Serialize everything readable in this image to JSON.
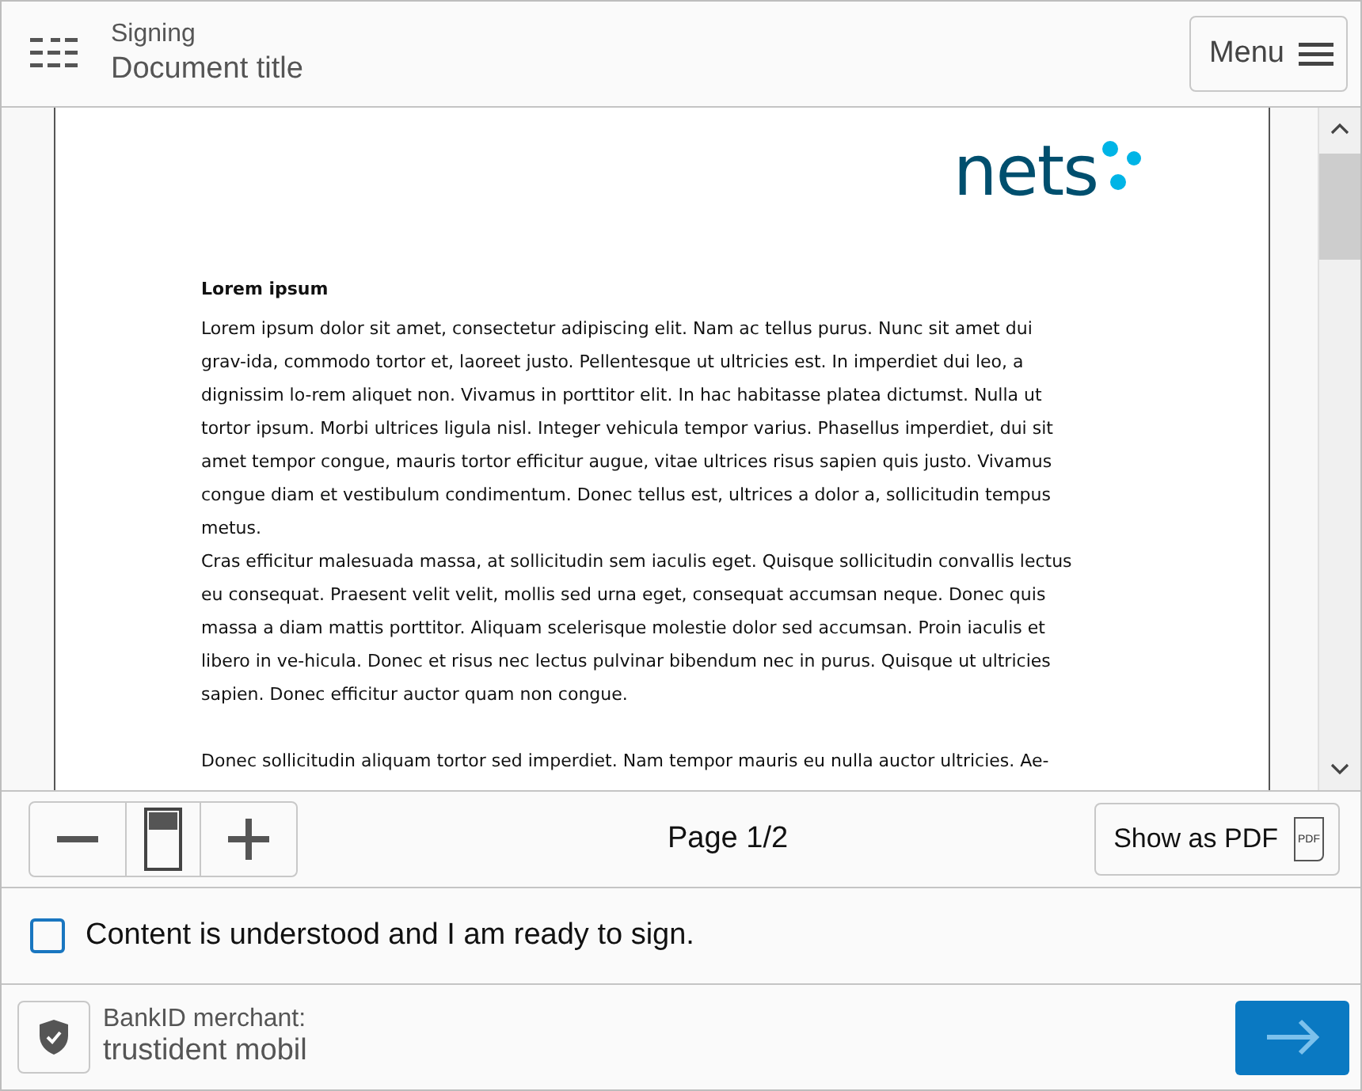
{
  "header": {
    "subtitle": "Signing",
    "title": "Document title",
    "menu_button": "Menu"
  },
  "document": {
    "logo": "nets",
    "heading": "Lorem ipsum",
    "paragraphs": [
      [
        "Lorem ipsum dolor sit amet, consectetur adipiscing elit. Nam ac tellus purus. Nunc sit amet dui",
        "grav-ida, commodo tortor et, laoreet justo. Pellentesque ut ultricies est. In imperdiet dui leo, a",
        "dignissim lo-rem aliquet non. Vivamus in porttitor elit. In hac habitasse platea dictumst. Nulla ut",
        "tortor ipsum. Morbi ultrices ligula nisl. Integer vehicula tempor varius. Phasellus imperdiet, dui sit",
        "amet tempor congue, mauris tortor efficitur augue, vitae ultrices risus sapien quis justo. Vivamus",
        "congue diam et vestibulum condimentum. Donec tellus est, ultrices a dolor a, sollicitudin tempus",
        "metus."
      ],
      [
        "Cras efficitur malesuada massa, at sollicitudin sem iaculis eget. Quisque sollicitudin convallis lectus",
        "eu consequat. Praesent velit velit, mollis sed urna eget, consequat accumsan neque. Donec quis",
        "massa a diam mattis porttitor. Aliquam scelerisque molestie dolor sed accumsan. Proin iaculis et",
        "libero in ve-hicula. Donec et risus nec lectus pulvinar bibendum nec in purus. Quisque ut ultricies",
        "sapien. Donec efficitur auctor quam non congue."
      ],
      [
        "Donec sollicitudin aliquam tortor sed imperdiet. Nam tempor mauris eu nulla auctor ultricies. Ae-"
      ]
    ]
  },
  "toolbar": {
    "page_label": "Page 1/2",
    "pdf_button": "Show as PDF",
    "pdf_icon_label": "PDF"
  },
  "confirm": {
    "label": "Content is understood and I am ready to sign.",
    "checked": false
  },
  "footer": {
    "merchant_label": "BankID merchant:",
    "merchant_name": "trustident mobil"
  }
}
